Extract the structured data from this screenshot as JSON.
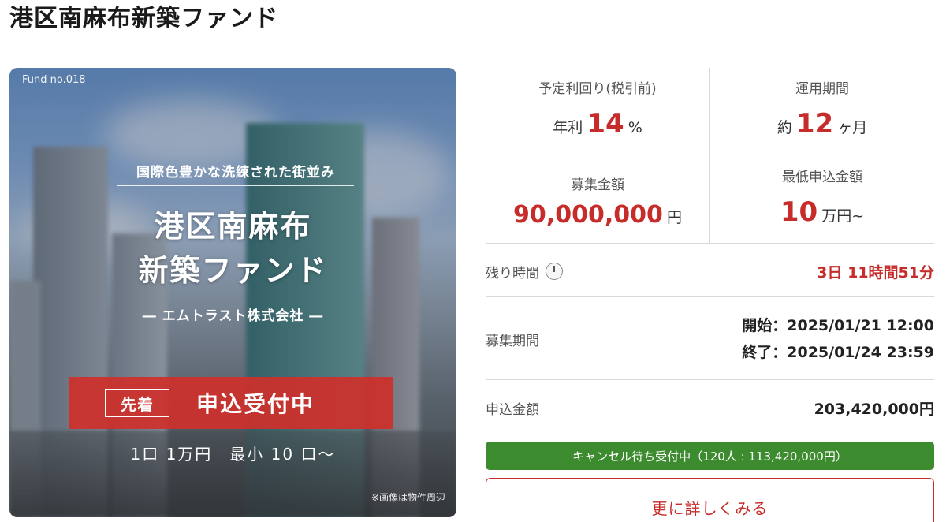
{
  "page": {
    "title": "港区南麻布新築ファンド"
  },
  "hero": {
    "fund_no": "Fund no.018",
    "tagline": "国際色豊かな洗練された街並み",
    "title_line1": "港区南麻布",
    "title_line2": "新築ファンド",
    "company": "― エムトラスト株式会社 ―",
    "badge": "先着",
    "status": "申込受付中",
    "units": "1口 1万円　最小 10 口〜",
    "note": "※画像は物件周辺"
  },
  "stats": {
    "yield": {
      "label": "予定利回り(税引前)",
      "prefix": "年利",
      "value": "14",
      "unit": "%"
    },
    "term": {
      "label": "運用期間",
      "prefix": "約",
      "value": "12",
      "unit": "ヶ月"
    },
    "amount": {
      "label": "募集金額",
      "value": "90,000,000",
      "unit": "円"
    },
    "minimum": {
      "label": "最低申込金額",
      "value": "10",
      "unit": "万円~"
    }
  },
  "remaining": {
    "label": "残り時間",
    "value": "3日 11時間51分"
  },
  "period": {
    "label": "募集期間",
    "start": "開始：2025/01/21 12:00",
    "end": "終了：2025/01/24 23:59"
  },
  "applied": {
    "label": "申込金額",
    "value": "203,420,000円"
  },
  "waitlist": {
    "text": "キャンセル待ち受付中（120人 : 113,420,000円）"
  },
  "more_button": {
    "label": "更に詳しくみる"
  },
  "colors": {
    "accent_red": "#c62d2a",
    "wait_green": "#3d8b2f"
  }
}
